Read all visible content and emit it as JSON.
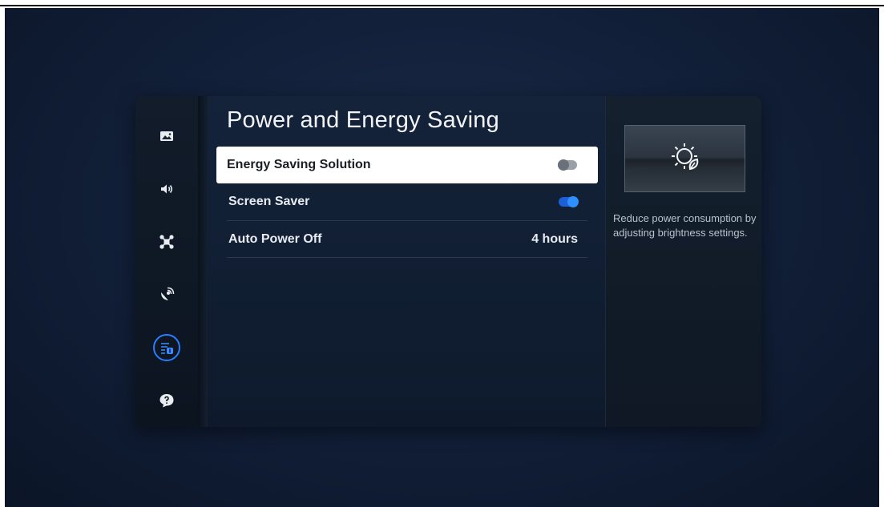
{
  "panel": {
    "title": "Power and Energy Saving"
  },
  "sidebar": {
    "items": [
      {
        "name": "picture",
        "icon": "picture-icon",
        "active": false
      },
      {
        "name": "sound",
        "icon": "speaker-icon",
        "active": false
      },
      {
        "name": "connection",
        "icon": "connection-icon",
        "active": false
      },
      {
        "name": "broadcasting",
        "icon": "satellite-icon",
        "active": false
      },
      {
        "name": "general",
        "icon": "general-settings-icon",
        "active": true
      },
      {
        "name": "support",
        "icon": "support-icon",
        "active": false
      }
    ]
  },
  "menu": {
    "items": [
      {
        "label": "Energy Saving Solution",
        "control": "toggle",
        "state": "off",
        "focused": true
      },
      {
        "label": "Screen Saver",
        "control": "toggle",
        "state": "on",
        "focused": false
      },
      {
        "label": "Auto Power Off",
        "control": "value",
        "value": "4 hours",
        "focused": false
      }
    ]
  },
  "info": {
    "icon": "energy-saving-icon",
    "description": "Reduce power consumption by adjusting brightness settings."
  },
  "colors": {
    "accent": "#2e8fff",
    "background": "#12203a",
    "focus": "#ffffff"
  }
}
